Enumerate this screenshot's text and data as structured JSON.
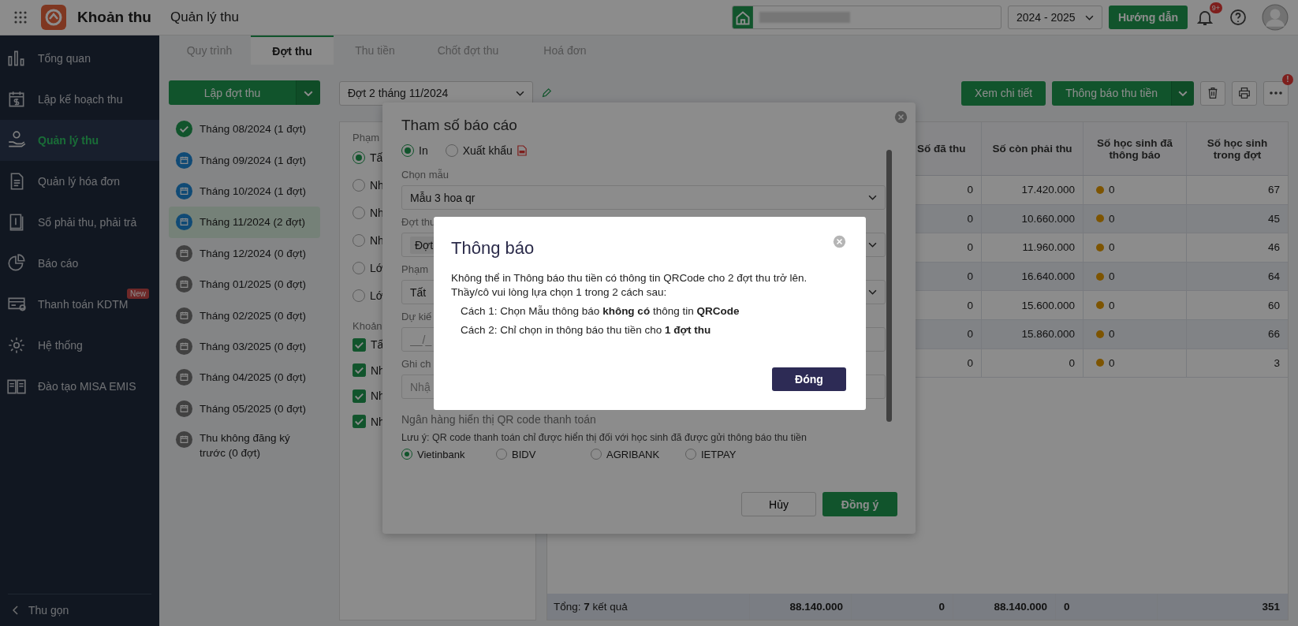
{
  "app": {
    "name": "Khoản thu",
    "section": "Quản lý thu"
  },
  "header": {
    "year": "2024 - 2025",
    "guide_button": "Hướng dẫn",
    "notification_badge": "9+"
  },
  "sidebar": {
    "items": [
      {
        "label": "Tổng quan",
        "selected": false
      },
      {
        "label": "Lập kế hoạch thu",
        "selected": false
      },
      {
        "label": "Quản lý thu",
        "selected": true
      },
      {
        "label": "Quản lý hóa đơn",
        "selected": false
      },
      {
        "label": "Sổ phải thu, phải trả",
        "selected": false
      },
      {
        "label": "Báo cáo",
        "selected": false
      },
      {
        "label": "Thanh toán KDTM",
        "selected": false,
        "badge": "New"
      },
      {
        "label": "Hệ thống",
        "selected": false
      },
      {
        "label": "Đào tạo MISA EMIS",
        "selected": false
      }
    ],
    "collapse": "Thu gọn"
  },
  "tabs": [
    {
      "label": "Quy trình",
      "selected": false
    },
    {
      "label": "Đợt thu",
      "selected": true
    },
    {
      "label": "Thu tiền",
      "selected": false
    },
    {
      "label": "Chốt đợt thu",
      "selected": false
    },
    {
      "label": "Hoá đơn",
      "selected": false
    }
  ],
  "batch_panel": {
    "create_button": "Lập đợt thu",
    "items": [
      {
        "label": "Tháng 08/2024 (1 đợt)",
        "kind": "done",
        "selected": false
      },
      {
        "label": "Tháng 09/2024 (1 đợt)",
        "kind": "active",
        "selected": false
      },
      {
        "label": "Tháng 10/2024 (1 đợt)",
        "kind": "active",
        "selected": false
      },
      {
        "label": "Tháng 11/2024 (2 đợt)",
        "kind": "active",
        "selected": true
      },
      {
        "label": "Tháng 12/2024 (0 đợt)",
        "kind": "empty",
        "selected": false
      },
      {
        "label": "Tháng 01/2025 (0 đợt)",
        "kind": "empty",
        "selected": false
      },
      {
        "label": "Tháng 02/2025 (0 đợt)",
        "kind": "empty",
        "selected": false
      },
      {
        "label": "Tháng 03/2025 (0 đợt)",
        "kind": "empty",
        "selected": false
      },
      {
        "label": "Tháng 04/2025 (0 đợt)",
        "kind": "empty",
        "selected": false
      },
      {
        "label": "Tháng 05/2025 (0 đợt)",
        "kind": "empty",
        "selected": false
      },
      {
        "label": "Thu không đăng ký trước (0 đợt)",
        "kind": "empty",
        "selected": false
      }
    ]
  },
  "toolbar": {
    "batch_select": "Đợt 2 tháng 11/2024",
    "details_button": "Xem chi tiết",
    "notify_button": "Thông báo thu tiền",
    "more_badge": "!"
  },
  "filter_panel": {
    "label_1": "Phạm",
    "radios": [
      {
        "label": "Tấ",
        "selected": true
      },
      {
        "label": "Nh",
        "selected": false
      },
      {
        "label": "Nh",
        "selected": false
      },
      {
        "label": "Nh",
        "selected": false
      },
      {
        "label": "Lớ",
        "selected": false
      },
      {
        "label": "Lớ",
        "selected": false
      }
    ],
    "label_2": "Khoản",
    "checkboxes": [
      {
        "label": "Tấ",
        "checked": true
      },
      {
        "label": "Nh",
        "checked": true
      },
      {
        "label": "Nh",
        "checked": true
      },
      {
        "label": "Nh",
        "checked": true
      }
    ]
  },
  "table": {
    "columns": [
      "Số đã thu",
      "Số còn phải thu",
      "Số học sinh đã thông báo",
      "Số học sinh trong đợt"
    ],
    "rows": [
      {
        "collected": "0",
        "remaining": "17.420.000",
        "notified": "0",
        "students": "67"
      },
      {
        "collected": "0",
        "remaining": "10.660.000",
        "notified": "0",
        "students": "45"
      },
      {
        "collected": "0",
        "remaining": "11.960.000",
        "notified": "0",
        "students": "46"
      },
      {
        "collected": "0",
        "remaining": "16.640.000",
        "notified": "0",
        "students": "64"
      },
      {
        "collected": "0",
        "remaining": "15.600.000",
        "notified": "0",
        "students": "60"
      },
      {
        "collected": "0",
        "remaining": "15.860.000",
        "notified": "0",
        "students": "66"
      },
      {
        "collected": "0",
        "remaining": "0",
        "notified": "0",
        "students": "3"
      }
    ],
    "footer": {
      "label": "Tổng: **7** kết quả",
      "values": [
        "88.140.000",
        "0",
        "88.140.000",
        "0",
        "351"
      ]
    }
  },
  "report_dialog": {
    "title": "Tham số báo cáo",
    "modes": [
      {
        "label": "In",
        "selected": true
      },
      {
        "label": "Xuất khẩu",
        "selected": false
      }
    ],
    "template_label": "Chọn mẫu",
    "template_value": "Mẫu 3 hoa qr",
    "batch_label": "Đợt thu",
    "batch_chip": "Đợt",
    "scope_label": "Phạm",
    "scope_value": "Tất",
    "date_label": "Dự kiế",
    "date_placeholder": "__/_",
    "note_label": "Ghi ch",
    "note_placeholder": "Nhậ",
    "bank_title": "Ngân hàng hiển thị QR code thanh toán",
    "bank_note": "Lưu ý: QR code thanh toán chỉ được hiển thị đối với học sinh đã được gửi thông báo thu tiền",
    "banks": [
      {
        "label": "Vietinbank",
        "selected": true
      },
      {
        "label": "BIDV",
        "selected": false
      },
      {
        "label": "AGRIBANK",
        "selected": false
      },
      {
        "label": "IETPAY",
        "selected": false
      }
    ],
    "cancel_button": "Hủy",
    "ok_button": "Đồng ý"
  },
  "alert_dialog": {
    "title": "Thông báo",
    "message": "Không thể in Thông báo thu tiền có thông tin QRCode cho 2 đợt thu trở lên.",
    "message_2": "Thầy/cô vui lòng lựa chọn 1 trong 2 cách sau:",
    "options": [
      "Cách 1: Chọn Mẫu thông báo **không có** thông tin **QRCode**",
      "Cách 2: Chỉ chọn in thông báo thu tiền cho **1 đợt thu**"
    ],
    "close_button": "Đóng"
  }
}
